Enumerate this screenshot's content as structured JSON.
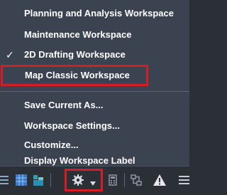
{
  "menu": {
    "items": [
      {
        "label": "Planning and Analysis Workspace",
        "checked": false
      },
      {
        "label": "Maintenance Workspace",
        "checked": false
      },
      {
        "label": "2D Drafting Workspace",
        "checked": true
      },
      {
        "label": "Map Classic Workspace",
        "checked": false,
        "highlighted": true
      }
    ],
    "actions": [
      {
        "label": "Save Current As..."
      },
      {
        "label": "Workspace Settings..."
      },
      {
        "label": "Customize..."
      },
      {
        "label": "Display Workspace Label"
      }
    ],
    "check_glyph": "✓"
  },
  "toolbar": {
    "icons": [
      "grid-lines-icon",
      "blue-grid-icon",
      "teal-folder-icon",
      "gear-icon",
      "dropdown-arrow-icon",
      "calculator-icon",
      "hierarchy-icon",
      "warning-icon",
      "menu-lines-icon"
    ]
  },
  "colors": {
    "menu_bg": "#3b4250",
    "text": "#ffffff",
    "highlight_border": "#d41e24",
    "toolbar_bg": "#2b2f36"
  }
}
